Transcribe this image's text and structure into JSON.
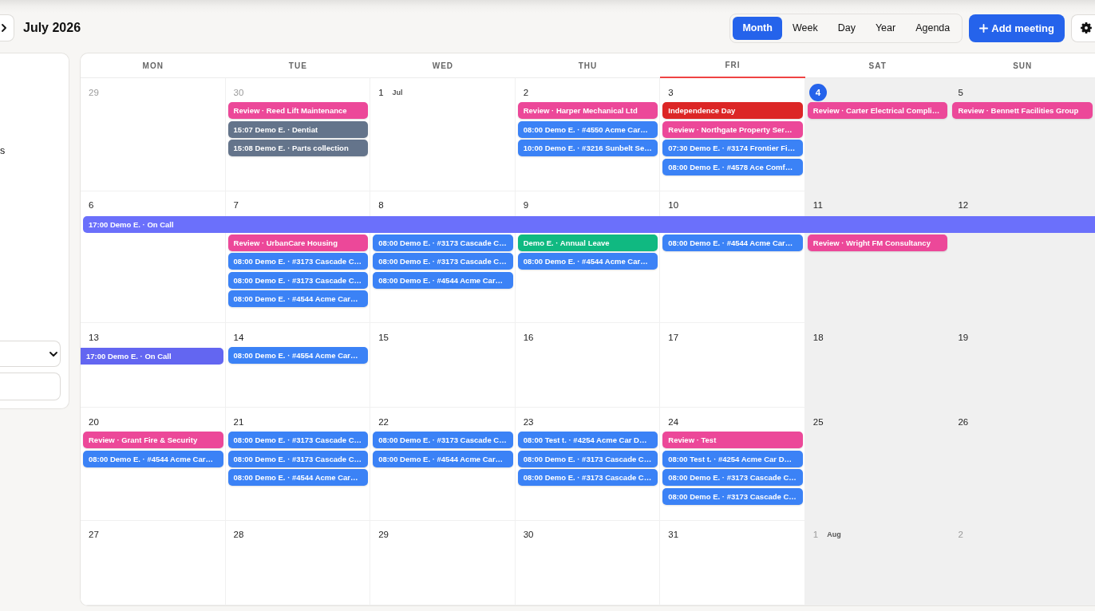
{
  "toolbar": {
    "title": "July 2026",
    "views": [
      {
        "label": "Month",
        "selected": true
      },
      {
        "label": "Week",
        "selected": false
      },
      {
        "label": "Day",
        "selected": false
      },
      {
        "label": "Year",
        "selected": false
      },
      {
        "label": "Agenda",
        "selected": false
      }
    ],
    "add_button": "Add meeting"
  },
  "sidebar": {
    "text": "s"
  },
  "calendar": {
    "weekdays": [
      {
        "label": "MON",
        "weekend": false,
        "highlighted": false
      },
      {
        "label": "TUE",
        "weekend": false,
        "highlighted": false
      },
      {
        "label": "WED",
        "weekend": false,
        "highlighted": false
      },
      {
        "label": "THU",
        "weekend": false,
        "highlighted": false
      },
      {
        "label": "FRI",
        "weekend": false,
        "highlighted": true
      },
      {
        "label": "SAT",
        "weekend": true,
        "highlighted": false
      },
      {
        "label": "SUN",
        "weekend": true,
        "highlighted": false
      }
    ],
    "weeks": [
      {
        "days": [
          {
            "date": "29",
            "today": false,
            "outside_month": true
          },
          {
            "date": "30",
            "today": false,
            "outside_month": true,
            "events": [
              {
                "label": "Review · Reed Lift Maintenance",
                "color": "#ec4899"
              },
              {
                "label": "15:07 Demo E. · Dentiat",
                "color": "#64748b"
              },
              {
                "label": "15:08 Demo E. · Parts collection",
                "color": "#64748b"
              }
            ]
          },
          {
            "date": "1",
            "month_label": "Jul",
            "today": false,
            "outside_month": false
          },
          {
            "date": "2",
            "today": false,
            "outside_month": false,
            "events": [
              {
                "label": "Review · Harper Mechanical Ltd",
                "color": "#ec4899"
              },
              {
                "label": "08:00 Demo E. · #4550 Acme Car…",
                "color": "#3b82f6"
              },
              {
                "label": "10:00 Demo E. · #3216 Sunbelt Se…",
                "color": "#3b82f6"
              }
            ]
          },
          {
            "date": "3",
            "today": false,
            "outside_month": false,
            "events": [
              {
                "label": "Independence Day",
                "color": "#dc2626"
              },
              {
                "label": "Review · Northgate Property Ser…",
                "color": "#ec4899"
              },
              {
                "label": "07:30 Demo E. · #3174 Frontier Fi…",
                "color": "#3b82f6"
              },
              {
                "label": "08:00 Demo E. · #4578 Ace Comf…",
                "color": "#3b82f6"
              }
            ]
          },
          {
            "date": "4",
            "today": true,
            "outside_month": false,
            "events": [
              {
                "label": "Review · Carter Electrical Compli…",
                "color": "#ec4899"
              }
            ]
          },
          {
            "date": "5",
            "today": false,
            "outside_month": false,
            "events": [
              {
                "label": "Review · Bennett Facilities Group",
                "color": "#ec4899"
              }
            ]
          }
        ]
      },
      {
        "days": [
          {
            "date": "6",
            "today": false,
            "outside_month": false,
            "bar": {
              "label": "17:00 Demo E. · On Call",
              "color": "#6b70fb",
              "continues_before": false,
              "continues_after": true
            }
          },
          {
            "date": "7",
            "today": false,
            "outside_month": false,
            "events": [
              {
                "label": "Review · UrbanCare Housing",
                "color": "#ec4899"
              },
              {
                "label": "08:00 Demo E. · #3173 Cascade C…",
                "color": "#3b82f6"
              },
              {
                "label": "08:00 Demo E. · #3173 Cascade C…",
                "color": "#3b82f6"
              },
              {
                "label": "08:00 Demo E. · #4544 Acme Car…",
                "color": "#3b82f6"
              }
            ]
          },
          {
            "date": "8",
            "today": false,
            "outside_month": false,
            "events": [
              {
                "label": "08:00 Demo E. · #3173 Cascade C…",
                "color": "#3b82f6"
              },
              {
                "label": "08:00 Demo E. · #3173 Cascade C…",
                "color": "#3b82f6"
              },
              {
                "label": "08:00 Demo E. · #4544 Acme Car…",
                "color": "#3b82f6"
              }
            ]
          },
          {
            "date": "9",
            "today": false,
            "outside_month": false,
            "events": [
              {
                "label": "Demo E. · Annual Leave",
                "color": "#10b981"
              },
              {
                "label": "08:00 Demo E. · #4544 Acme Car…",
                "color": "#3b82f6"
              }
            ]
          },
          {
            "date": "10",
            "today": false,
            "outside_month": false,
            "events": [
              {
                "label": "08:00 Demo E. · #4544 Acme Car…",
                "color": "#3b82f6"
              }
            ]
          },
          {
            "date": "11",
            "today": false,
            "outside_month": false,
            "events": [
              {
                "label": "Review · Wright FM Consultancy",
                "color": "#ec4899"
              }
            ]
          },
          {
            "date": "12",
            "today": false,
            "outside_month": false
          }
        ]
      },
      {
        "days": [
          {
            "date": "13",
            "today": false,
            "outside_month": false,
            "bar": {
              "label": "17:00 Demo E. · On Call",
              "color": "#6366f1",
              "continues_before": true,
              "continues_after": false
            }
          },
          {
            "date": "14",
            "today": false,
            "outside_month": false,
            "events": [
              {
                "label": "08:00 Demo E. · #4554 Acme Car…",
                "color": "#3b82f6"
              }
            ]
          },
          {
            "date": "15",
            "today": false,
            "outside_month": false
          },
          {
            "date": "16",
            "today": false,
            "outside_month": false
          },
          {
            "date": "17",
            "today": false,
            "outside_month": false
          },
          {
            "date": "18",
            "today": false,
            "outside_month": false
          },
          {
            "date": "19",
            "today": false,
            "outside_month": false
          }
        ]
      },
      {
        "days": [
          {
            "date": "20",
            "today": false,
            "outside_month": false,
            "events": [
              {
                "label": "Review · Grant Fire & Security",
                "color": "#ec4899"
              },
              {
                "label": "08:00 Demo E. · #4544 Acme Car…",
                "color": "#3b82f6"
              }
            ]
          },
          {
            "date": "21",
            "today": false,
            "outside_month": false,
            "events": [
              {
                "label": "08:00 Demo E. · #3173 Cascade C…",
                "color": "#3b82f6"
              },
              {
                "label": "08:00 Demo E. · #3173 Cascade C…",
                "color": "#3b82f6"
              },
              {
                "label": "08:00 Demo E. · #4544 Acme Car…",
                "color": "#3b82f6"
              }
            ]
          },
          {
            "date": "22",
            "today": false,
            "outside_month": false,
            "events": [
              {
                "label": "08:00 Demo E. · #3173 Cascade C…",
                "color": "#3b82f6"
              },
              {
                "label": "08:00 Demo E. · #4544 Acme Car…",
                "color": "#3b82f6"
              }
            ]
          },
          {
            "date": "23",
            "today": false,
            "outside_month": false,
            "events": [
              {
                "label": "08:00 Test t. · #4254 Acme Car D…",
                "color": "#3b82f6"
              },
              {
                "label": "08:00 Demo E. · #3173 Cascade C…",
                "color": "#3b82f6"
              },
              {
                "label": "08:00 Demo E. · #3173 Cascade C…",
                "color": "#3b82f6"
              }
            ]
          },
          {
            "date": "24",
            "today": false,
            "outside_month": false,
            "events": [
              {
                "label": "Review · Test",
                "color": "#ec4899"
              },
              {
                "label": "08:00 Test t. · #4254 Acme Car D…",
                "color": "#3b82f6"
              },
              {
                "label": "08:00 Demo E. · #3173 Cascade C…",
                "color": "#3b82f6"
              },
              {
                "label": "08:00 Demo E. · #3173 Cascade C…",
                "color": "#3b82f6"
              }
            ]
          },
          {
            "date": "25",
            "today": false,
            "outside_month": false
          },
          {
            "date": "26",
            "today": false,
            "outside_month": false
          }
        ]
      },
      {
        "days": [
          {
            "date": "27",
            "today": false,
            "outside_month": false
          },
          {
            "date": "28",
            "today": false,
            "outside_month": false
          },
          {
            "date": "29",
            "today": false,
            "outside_month": false
          },
          {
            "date": "30",
            "today": false,
            "outside_month": false
          },
          {
            "date": "31",
            "today": false,
            "outside_month": false
          },
          {
            "date": "1",
            "month_label": "Aug",
            "today": false,
            "outside_month": true
          },
          {
            "date": "2",
            "today": false,
            "outside_month": true
          }
        ]
      }
    ]
  }
}
